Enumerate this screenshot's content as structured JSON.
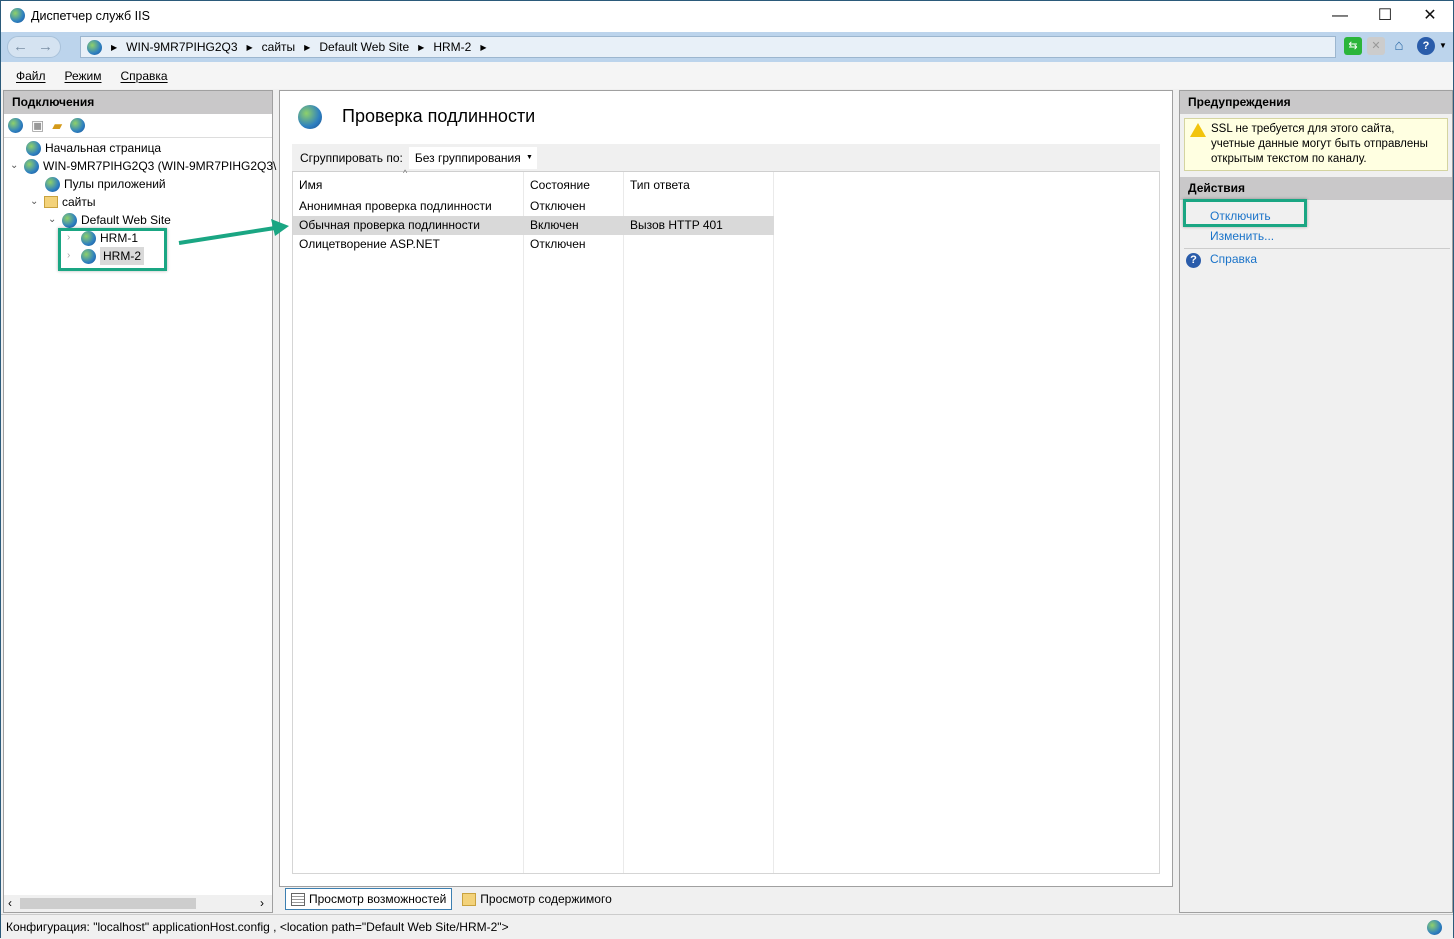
{
  "window": {
    "title": "Диспетчер служб IIS",
    "minimize": "—",
    "maximize": "☐",
    "close": "✕"
  },
  "address": {
    "crumbs": [
      "WIN-9MR7PIHG2Q3",
      "сайты",
      "Default Web Site",
      "HRM-2"
    ]
  },
  "menu": [
    "Файл",
    "Режим",
    "Справка"
  ],
  "connections": {
    "title": "Подключения",
    "tree": [
      {
        "label": "Начальная страница",
        "level": 0
      },
      {
        "label": "WIN-9MR7PIHG2Q3 (WIN-9MR7PIHG2Q3\\",
        "level": 0
      },
      {
        "label": "Пулы приложений",
        "level": 1
      },
      {
        "label": "сайты",
        "level": 1
      },
      {
        "label": "Default Web Site",
        "level": 2
      },
      {
        "label": "HRM-1",
        "level": 3
      },
      {
        "label": "HRM-2",
        "level": 3,
        "selected": true
      }
    ]
  },
  "main": {
    "title": "Проверка подлинности",
    "group_label": "Сгруппировать по:",
    "group_value": "Без группирования",
    "columns": [
      "Имя",
      "Состояние",
      "Тип ответа"
    ],
    "rows": [
      {
        "name": "Анонимная проверка подлинности",
        "state": "Отключен",
        "type": ""
      },
      {
        "name": "Обычная проверка подлинности",
        "state": "Включен",
        "type": "Вызов HTTP 401",
        "selected": true
      },
      {
        "name": "Олицетворение ASP.NET",
        "state": "Отключен",
        "type": ""
      }
    ],
    "tabs": [
      "Просмотр возможностей",
      "Просмотр содержимого"
    ]
  },
  "alerts": {
    "title": "Предупреждения",
    "text": "SSL не требуется для этого сайта, учетные данные могут быть отправлены открытым текстом по каналу."
  },
  "actions": {
    "title": "Действия",
    "items": [
      "Отключить",
      "Изменить...",
      "Справка"
    ]
  },
  "status": "Конфигурация: \"localhost\" applicationHost.config , <location path=\"Default Web Site/HRM-2\">",
  "colors": {
    "accent": "#1aa683",
    "link": "#1a73c9"
  }
}
